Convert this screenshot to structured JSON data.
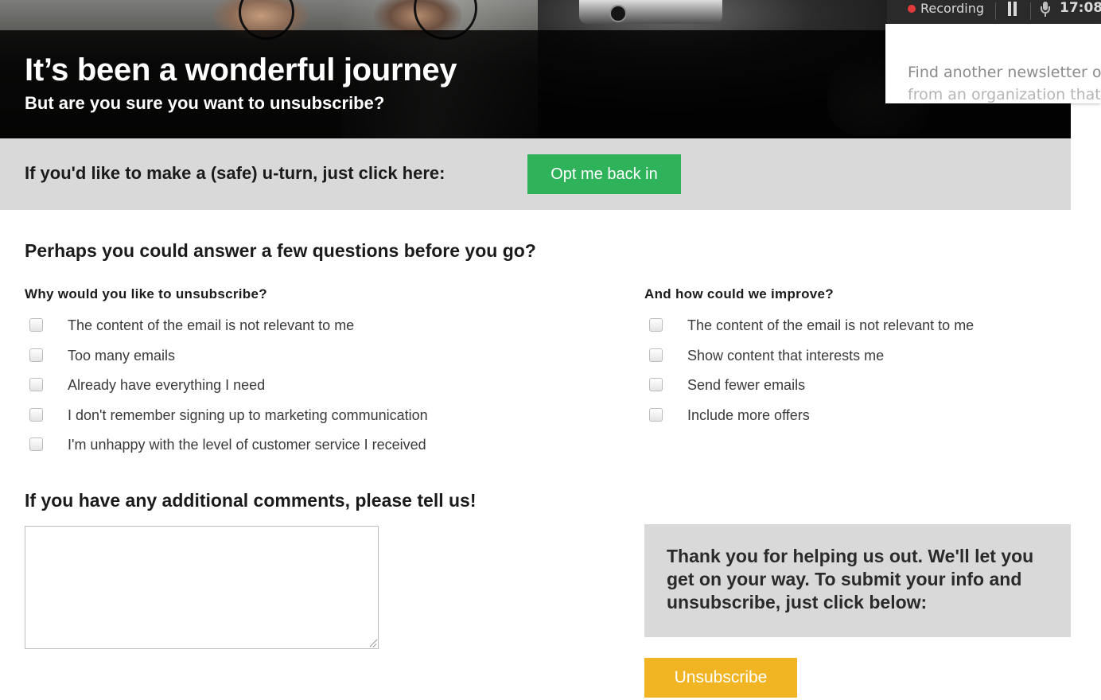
{
  "hero": {
    "title": "It’s been a wonderful journey",
    "subtitle": "But are you sure you want to unsubscribe?"
  },
  "recording_bar": {
    "status": "Recording",
    "time": "17:08",
    "status_color": "#e23a3a"
  },
  "popup": {
    "line1": "Find another newsletter o",
    "line2": "from an organization that"
  },
  "uturn": {
    "text": "If you'd like to make a (safe) u-turn, just click here:",
    "button_label": "Opt me back in",
    "button_color": "#2fb35a"
  },
  "questions": {
    "heading": "Perhaps you could answer a few questions before you go?",
    "reasons": {
      "heading": "Why would you like to unsubscribe?",
      "options": [
        "The content of the email is not relevant to me",
        "Too many emails",
        "Already have everything I need",
        "I don't remember signing up to marketing communication",
        "I'm unhappy with the level of customer service I received"
      ]
    },
    "improve": {
      "heading": "And how could we improve?",
      "options": [
        "The content of the email is not relevant to me",
        "Show content that interests me",
        "Send fewer emails",
        "Include more offers"
      ]
    }
  },
  "comments": {
    "heading": "If you have any additional comments, please tell us!",
    "value": ""
  },
  "thanks": {
    "text": "Thank you for helping us out. We'll let you get on your way. To submit your info and unsubscribe, just click below:"
  },
  "unsubscribe": {
    "button_label": "Unsubscribe",
    "button_color": "#f1b524"
  }
}
